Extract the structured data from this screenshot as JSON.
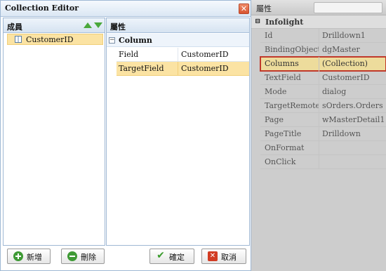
{
  "dialog": {
    "title": "Collection Editor",
    "close_icon": "close-icon"
  },
  "members_panel": {
    "header": "成員",
    "move_up_icon": "arrow-up-icon",
    "move_down_icon": "arrow-down-icon",
    "items": [
      {
        "label": "CustomerID",
        "selected": true,
        "icon": "column-icon"
      }
    ]
  },
  "properties_panel": {
    "header": "屬性",
    "group": {
      "label": "Column",
      "expanded": true
    },
    "rows": [
      {
        "name": "Field",
        "value": "CustomerID",
        "selected": false
      },
      {
        "name": "TargetField",
        "value": "CustomerID",
        "selected": true
      }
    ]
  },
  "buttons": {
    "add": "新增",
    "delete": "刪除",
    "ok": "確定",
    "cancel": "取消"
  },
  "property_grid": {
    "header": "屬性",
    "search_placeholder": "",
    "group": {
      "label": "Infolight",
      "expanded": true
    },
    "rows": [
      {
        "name": "Id",
        "value": "Drilldown1"
      },
      {
        "name": "BindingObject",
        "value": "dgMaster"
      },
      {
        "name": "Columns",
        "value": "(Collection)",
        "highlighted": true
      },
      {
        "name": "TextField",
        "value": "CustomerID"
      },
      {
        "name": "Mode",
        "value": "dialog"
      },
      {
        "name": "TargetRemoteName",
        "value": "sOrders.Orders"
      },
      {
        "name": "Page",
        "value": "wMasterDetail1"
      },
      {
        "name": "PageTitle",
        "value": "Drilldown"
      },
      {
        "name": "OnFormat",
        "value": ""
      },
      {
        "name": "OnClick",
        "value": ""
      }
    ]
  },
  "colors": {
    "selection": "#fbe3a3",
    "highlight_outline": "#c0392b",
    "accent_green": "#4aa83c",
    "close_red": "#d8532f"
  }
}
